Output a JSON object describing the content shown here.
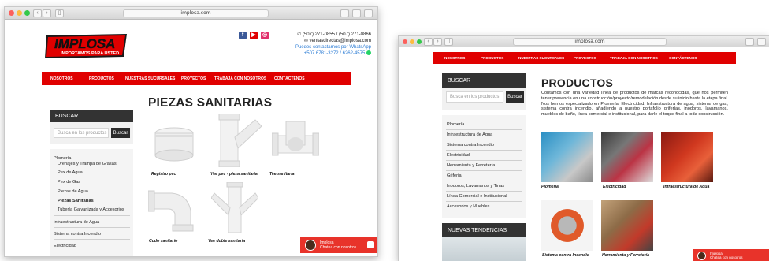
{
  "left": {
    "url": "implosa.com",
    "logo": {
      "name": "IMPLOSA",
      "tagline": "IMPORTAMOS PARA USTED"
    },
    "contact": {
      "phones": "(507) 271-0855 / (507) 271-0866",
      "email": "ventasdirectas@implosa.com",
      "whatsapp_label": "Puedes contactarnos por WhatsApp",
      "whatsapp_numbers": "+507 6781-3272 / 6262-4575"
    },
    "nav": [
      "NOSOTROS",
      "PRODUCTOS",
      "NUESTRAS SUCURSALES",
      "PROYECTOS",
      "TRABAJA CON NOSOTROS",
      "CONTÁCTENOS"
    ],
    "search": {
      "heading": "BUSCAR",
      "placeholder": "Busca en los productos",
      "button": "Buscar"
    },
    "menu": [
      "Plomería",
      "Drenajes y Trampa de Grasas",
      "Pex de Agua",
      "Pex de Gas",
      "Piezas de Agua",
      "Piezas Sanitarias",
      "Tubería Galvanizada y Accesorios",
      "Infraestructura de Agua",
      "Sistema contra Incendio",
      "Electricidad"
    ],
    "page_title": "PIEZAS SANITARIAS",
    "products": [
      "Registro pvc",
      "Yee pvc - pieza sanitaria",
      "Tee sanitaria",
      "Codo sanitario",
      "Yee doble sanitaria"
    ],
    "chat": {
      "title": "Implosa",
      "subtitle": "Chatea con nosotros"
    }
  },
  "right": {
    "url": "implosa.com",
    "nav": [
      "NOSOTROS",
      "PRODUCTOS",
      "NUESTRAS SUCURSALES",
      "PROYECTOS",
      "TRABAJA CON NOSOTROS",
      "CONTÁCTENOS"
    ],
    "search": {
      "heading": "BUSCAR",
      "placeholder": "Busca en los productos",
      "button": "Buscar"
    },
    "menu": [
      "Plomería",
      "Infraestructura de Agua",
      "Sistema contra Incendio",
      "Electricidad",
      "Herramienta y Ferretería",
      "Grifería",
      "Inodoros, Lavamanos y Tinas",
      "Línea Comercial e Institucional",
      "Accesorios y Muebles"
    ],
    "trends_heading": "NUEVAS TENDENCIAS",
    "page_title": "PRODUCTOS",
    "description": "Contamos con una variedad línea de productos de marcas reconocidas, que nos permiten tener presencia en una construcción/proyecto/remodelación desde su inicio hasta la etapa final. Nos hemos especializado en Plomería, Electricidad, Infraestructura de agua, sistema de gas, sistema contra incendio, añadiendo a nuestro portafolio griferías, inodoros, lavamanos, muebles de baño, línea comercial e institucional, para darle el toque final a toda construcción.",
    "categories": [
      "Plomería",
      "Electricidad",
      "Infraestructura de Agua",
      "Sistema contra Incendio",
      "Herramienta y Ferretería"
    ],
    "chat": {
      "title": "Implosa",
      "subtitle": "Chatea con nosotros"
    }
  },
  "colors": {
    "brand_red": "#e00000",
    "dark": "#333333",
    "whatsapp": "#25d366"
  }
}
